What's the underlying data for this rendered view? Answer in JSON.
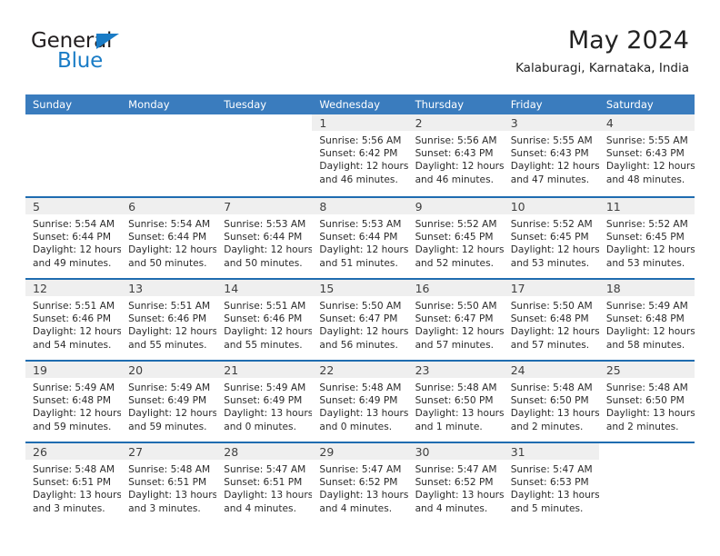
{
  "brand": {
    "name_top": "General",
    "name_bottom": "Blue",
    "triangle_icon": "brand-triangle-icon",
    "color_dark": "#231f20",
    "color_blue": "#1a7cc6"
  },
  "header": {
    "title": "May 2024",
    "subtitle": "Kalaburagi, Karnataka, India"
  },
  "colors": {
    "header_band": "#3a7cbe",
    "week_divider": "#1f6cb0",
    "day_band": "#efefef",
    "text": "#2b2b2b"
  },
  "weekdays": [
    "Sunday",
    "Monday",
    "Tuesday",
    "Wednesday",
    "Thursday",
    "Friday",
    "Saturday"
  ],
  "weeks": [
    [
      {
        "empty": true
      },
      {
        "empty": true
      },
      {
        "empty": true
      },
      {
        "day": "1",
        "sunrise": "Sunrise: 5:56 AM",
        "sunset": "Sunset: 6:42 PM",
        "daylight1": "Daylight: 12 hours",
        "daylight2": "and 46 minutes."
      },
      {
        "day": "2",
        "sunrise": "Sunrise: 5:56 AM",
        "sunset": "Sunset: 6:43 PM",
        "daylight1": "Daylight: 12 hours",
        "daylight2": "and 46 minutes."
      },
      {
        "day": "3",
        "sunrise": "Sunrise: 5:55 AM",
        "sunset": "Sunset: 6:43 PM",
        "daylight1": "Daylight: 12 hours",
        "daylight2": "and 47 minutes."
      },
      {
        "day": "4",
        "sunrise": "Sunrise: 5:55 AM",
        "sunset": "Sunset: 6:43 PM",
        "daylight1": "Daylight: 12 hours",
        "daylight2": "and 48 minutes."
      }
    ],
    [
      {
        "day": "5",
        "sunrise": "Sunrise: 5:54 AM",
        "sunset": "Sunset: 6:44 PM",
        "daylight1": "Daylight: 12 hours",
        "daylight2": "and 49 minutes."
      },
      {
        "day": "6",
        "sunrise": "Sunrise: 5:54 AM",
        "sunset": "Sunset: 6:44 PM",
        "daylight1": "Daylight: 12 hours",
        "daylight2": "and 50 minutes."
      },
      {
        "day": "7",
        "sunrise": "Sunrise: 5:53 AM",
        "sunset": "Sunset: 6:44 PM",
        "daylight1": "Daylight: 12 hours",
        "daylight2": "and 50 minutes."
      },
      {
        "day": "8",
        "sunrise": "Sunrise: 5:53 AM",
        "sunset": "Sunset: 6:44 PM",
        "daylight1": "Daylight: 12 hours",
        "daylight2": "and 51 minutes."
      },
      {
        "day": "9",
        "sunrise": "Sunrise: 5:52 AM",
        "sunset": "Sunset: 6:45 PM",
        "daylight1": "Daylight: 12 hours",
        "daylight2": "and 52 minutes."
      },
      {
        "day": "10",
        "sunrise": "Sunrise: 5:52 AM",
        "sunset": "Sunset: 6:45 PM",
        "daylight1": "Daylight: 12 hours",
        "daylight2": "and 53 minutes."
      },
      {
        "day": "11",
        "sunrise": "Sunrise: 5:52 AM",
        "sunset": "Sunset: 6:45 PM",
        "daylight1": "Daylight: 12 hours",
        "daylight2": "and 53 minutes."
      }
    ],
    [
      {
        "day": "12",
        "sunrise": "Sunrise: 5:51 AM",
        "sunset": "Sunset: 6:46 PM",
        "daylight1": "Daylight: 12 hours",
        "daylight2": "and 54 minutes."
      },
      {
        "day": "13",
        "sunrise": "Sunrise: 5:51 AM",
        "sunset": "Sunset: 6:46 PM",
        "daylight1": "Daylight: 12 hours",
        "daylight2": "and 55 minutes."
      },
      {
        "day": "14",
        "sunrise": "Sunrise: 5:51 AM",
        "sunset": "Sunset: 6:46 PM",
        "daylight1": "Daylight: 12 hours",
        "daylight2": "and 55 minutes."
      },
      {
        "day": "15",
        "sunrise": "Sunrise: 5:50 AM",
        "sunset": "Sunset: 6:47 PM",
        "daylight1": "Daylight: 12 hours",
        "daylight2": "and 56 minutes."
      },
      {
        "day": "16",
        "sunrise": "Sunrise: 5:50 AM",
        "sunset": "Sunset: 6:47 PM",
        "daylight1": "Daylight: 12 hours",
        "daylight2": "and 57 minutes."
      },
      {
        "day": "17",
        "sunrise": "Sunrise: 5:50 AM",
        "sunset": "Sunset: 6:48 PM",
        "daylight1": "Daylight: 12 hours",
        "daylight2": "and 57 minutes."
      },
      {
        "day": "18",
        "sunrise": "Sunrise: 5:49 AM",
        "sunset": "Sunset: 6:48 PM",
        "daylight1": "Daylight: 12 hours",
        "daylight2": "and 58 minutes."
      }
    ],
    [
      {
        "day": "19",
        "sunrise": "Sunrise: 5:49 AM",
        "sunset": "Sunset: 6:48 PM",
        "daylight1": "Daylight: 12 hours",
        "daylight2": "and 59 minutes."
      },
      {
        "day": "20",
        "sunrise": "Sunrise: 5:49 AM",
        "sunset": "Sunset: 6:49 PM",
        "daylight1": "Daylight: 12 hours",
        "daylight2": "and 59 minutes."
      },
      {
        "day": "21",
        "sunrise": "Sunrise: 5:49 AM",
        "sunset": "Sunset: 6:49 PM",
        "daylight1": "Daylight: 13 hours",
        "daylight2": "and 0 minutes."
      },
      {
        "day": "22",
        "sunrise": "Sunrise: 5:48 AM",
        "sunset": "Sunset: 6:49 PM",
        "daylight1": "Daylight: 13 hours",
        "daylight2": "and 0 minutes."
      },
      {
        "day": "23",
        "sunrise": "Sunrise: 5:48 AM",
        "sunset": "Sunset: 6:50 PM",
        "daylight1": "Daylight: 13 hours",
        "daylight2": "and 1 minute."
      },
      {
        "day": "24",
        "sunrise": "Sunrise: 5:48 AM",
        "sunset": "Sunset: 6:50 PM",
        "daylight1": "Daylight: 13 hours",
        "daylight2": "and 2 minutes."
      },
      {
        "day": "25",
        "sunrise": "Sunrise: 5:48 AM",
        "sunset": "Sunset: 6:50 PM",
        "daylight1": "Daylight: 13 hours",
        "daylight2": "and 2 minutes."
      }
    ],
    [
      {
        "day": "26",
        "sunrise": "Sunrise: 5:48 AM",
        "sunset": "Sunset: 6:51 PM",
        "daylight1": "Daylight: 13 hours",
        "daylight2": "and 3 minutes."
      },
      {
        "day": "27",
        "sunrise": "Sunrise: 5:48 AM",
        "sunset": "Sunset: 6:51 PM",
        "daylight1": "Daylight: 13 hours",
        "daylight2": "and 3 minutes."
      },
      {
        "day": "28",
        "sunrise": "Sunrise: 5:47 AM",
        "sunset": "Sunset: 6:51 PM",
        "daylight1": "Daylight: 13 hours",
        "daylight2": "and 4 minutes."
      },
      {
        "day": "29",
        "sunrise": "Sunrise: 5:47 AM",
        "sunset": "Sunset: 6:52 PM",
        "daylight1": "Daylight: 13 hours",
        "daylight2": "and 4 minutes."
      },
      {
        "day": "30",
        "sunrise": "Sunrise: 5:47 AM",
        "sunset": "Sunset: 6:52 PM",
        "daylight1": "Daylight: 13 hours",
        "daylight2": "and 4 minutes."
      },
      {
        "day": "31",
        "sunrise": "Sunrise: 5:47 AM",
        "sunset": "Sunset: 6:53 PM",
        "daylight1": "Daylight: 13 hours",
        "daylight2": "and 5 minutes."
      },
      {
        "empty": true
      }
    ]
  ]
}
